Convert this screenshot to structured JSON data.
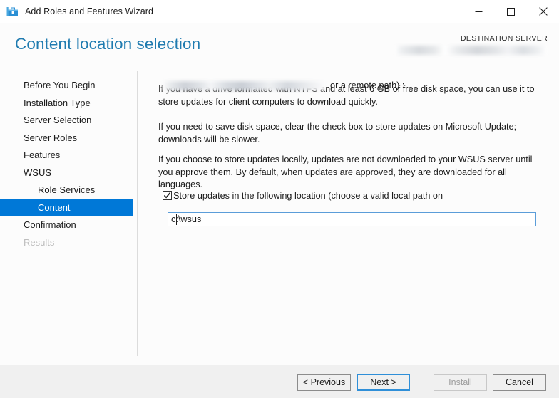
{
  "window": {
    "title": "Add Roles and Features Wizard",
    "icon": "wizard-toolbox-icon",
    "controls": {
      "minimize": "minimize-icon",
      "maximize": "maximize-icon",
      "close": "close-icon"
    }
  },
  "header": {
    "page_title": "Content location selection",
    "destination_label": "DESTINATION SERVER",
    "destination_value": "",
    "title_color": "#1f7bb0"
  },
  "sidebar": {
    "items": [
      {
        "label": "Before You Begin",
        "state": "normal",
        "indent": false
      },
      {
        "label": "Installation Type",
        "state": "normal",
        "indent": false
      },
      {
        "label": "Server Selection",
        "state": "normal",
        "indent": false
      },
      {
        "label": "Server Roles",
        "state": "normal",
        "indent": false
      },
      {
        "label": "Features",
        "state": "normal",
        "indent": false
      },
      {
        "label": "WSUS",
        "state": "normal",
        "indent": false
      },
      {
        "label": "Role Services",
        "state": "normal",
        "indent": true
      },
      {
        "label": "Content",
        "state": "selected",
        "indent": true
      },
      {
        "label": "Confirmation",
        "state": "normal",
        "indent": false
      },
      {
        "label": "Results",
        "state": "disabled",
        "indent": false
      }
    ],
    "selected_color": "#0078d7"
  },
  "main": {
    "paragraph1": "If you have a drive formatted with NTFS and at least 6 GB of free disk space, you can use it to store updates for client computers to download quickly.",
    "paragraph2": "If you need to save disk space, clear the check box to store updates on Microsoft Update; downloads will be slower.",
    "paragraph3": "If you choose to store updates locally, updates are not downloaded to your WSUS server until you approve them. By default, when updates are approved, they are downloaded for all languages.",
    "checkbox": {
      "checked": true,
      "label_line1": "Store updates in the following location (choose a valid local path on",
      "label_line2_suffix": ", or a remote path) :"
    },
    "path_field": {
      "value": "c:\\wsus",
      "placeholder": ""
    }
  },
  "footer": {
    "buttons": [
      {
        "label": "< Previous",
        "state": "normal"
      },
      {
        "label": "Next >",
        "state": "focused"
      },
      {
        "label": "Install",
        "state": "disabled"
      },
      {
        "label": "Cancel",
        "state": "normal"
      }
    ]
  }
}
